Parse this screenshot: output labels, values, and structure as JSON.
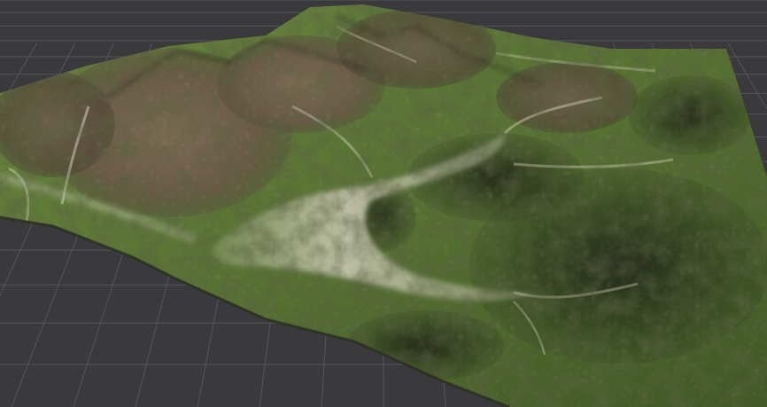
{
  "scene": {
    "kind": "3d-viewport",
    "content": "terrain-mesh",
    "palette": {
      "background": "#3a3a3d",
      "grid_line": "#55555a",
      "grass": "#5f7a35",
      "grass_dark": "#3c5222",
      "rock": "#6e5e4a",
      "rock_dark": "#3a3126",
      "riverbed": "#c9c7b4",
      "shadow": "#20231a"
    }
  }
}
